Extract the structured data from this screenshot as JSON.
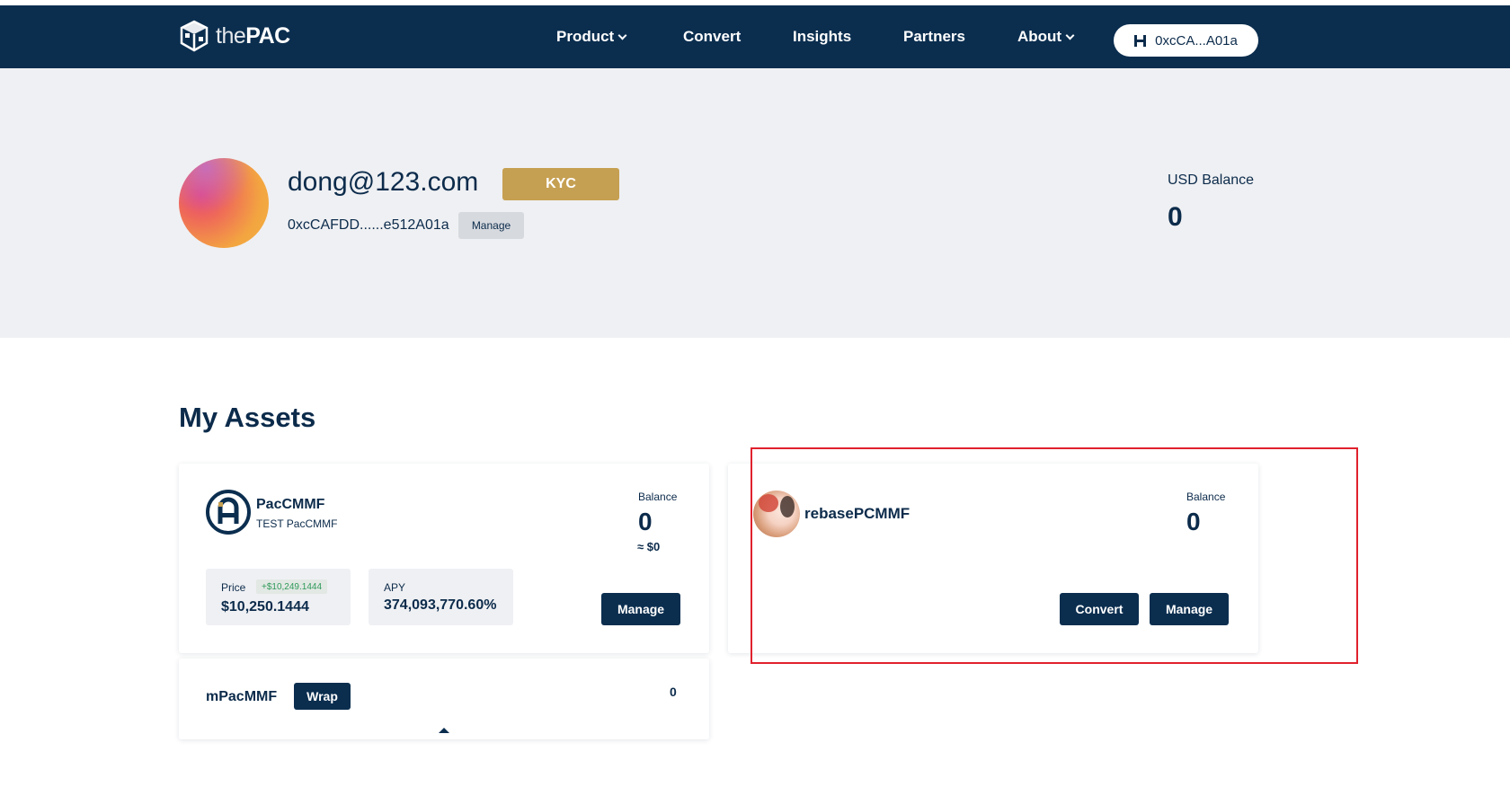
{
  "nav": {
    "logo": {
      "prefix": "the",
      "brand": "PAC"
    },
    "items": [
      {
        "label": "Product",
        "dropdown": true
      },
      {
        "label": "Convert",
        "dropdown": false
      },
      {
        "label": "Insights",
        "dropdown": false
      },
      {
        "label": "Partners",
        "dropdown": false
      },
      {
        "label": "About",
        "dropdown": true
      }
    ],
    "wallet": {
      "label": "0xcCA...A01a",
      "icon": "wallet-h-icon"
    }
  },
  "profile": {
    "email": "dong@123.com",
    "kyc_label": "KYC",
    "address": "0xcCAFDD......e512A01a",
    "manage_label": "Manage",
    "usd_balance_label": "USD Balance",
    "usd_balance_value": "0"
  },
  "assets": {
    "title": "My Assets",
    "cards": [
      {
        "name": "PacCMMF",
        "subtitle": "TEST PacCMMF",
        "icon": "paccmmf-coin-icon",
        "balance_label": "Balance",
        "balance_value": "0",
        "balance_usd": "≈ $0",
        "price_label": "Price",
        "price_change": "+$10,249.1444",
        "price_value": "$10,250.1444",
        "apy_label": "APY",
        "apy_value": "374,093,770.60%",
        "manage_label": "Manage"
      },
      {
        "name": "rebasePCMMF",
        "icon": "rebasepcmmf-token-icon",
        "balance_label": "Balance",
        "balance_value": "0",
        "convert_label": "Convert",
        "manage_label": "Manage"
      }
    ],
    "wrapped": {
      "name": "mPacMMF",
      "wrap_label": "Wrap",
      "value": "0"
    }
  },
  "colors": {
    "navy": "#0b2e4f",
    "gold": "#c6a052",
    "hero_bg": "#eff0f3",
    "highlight": "#e0212d"
  }
}
